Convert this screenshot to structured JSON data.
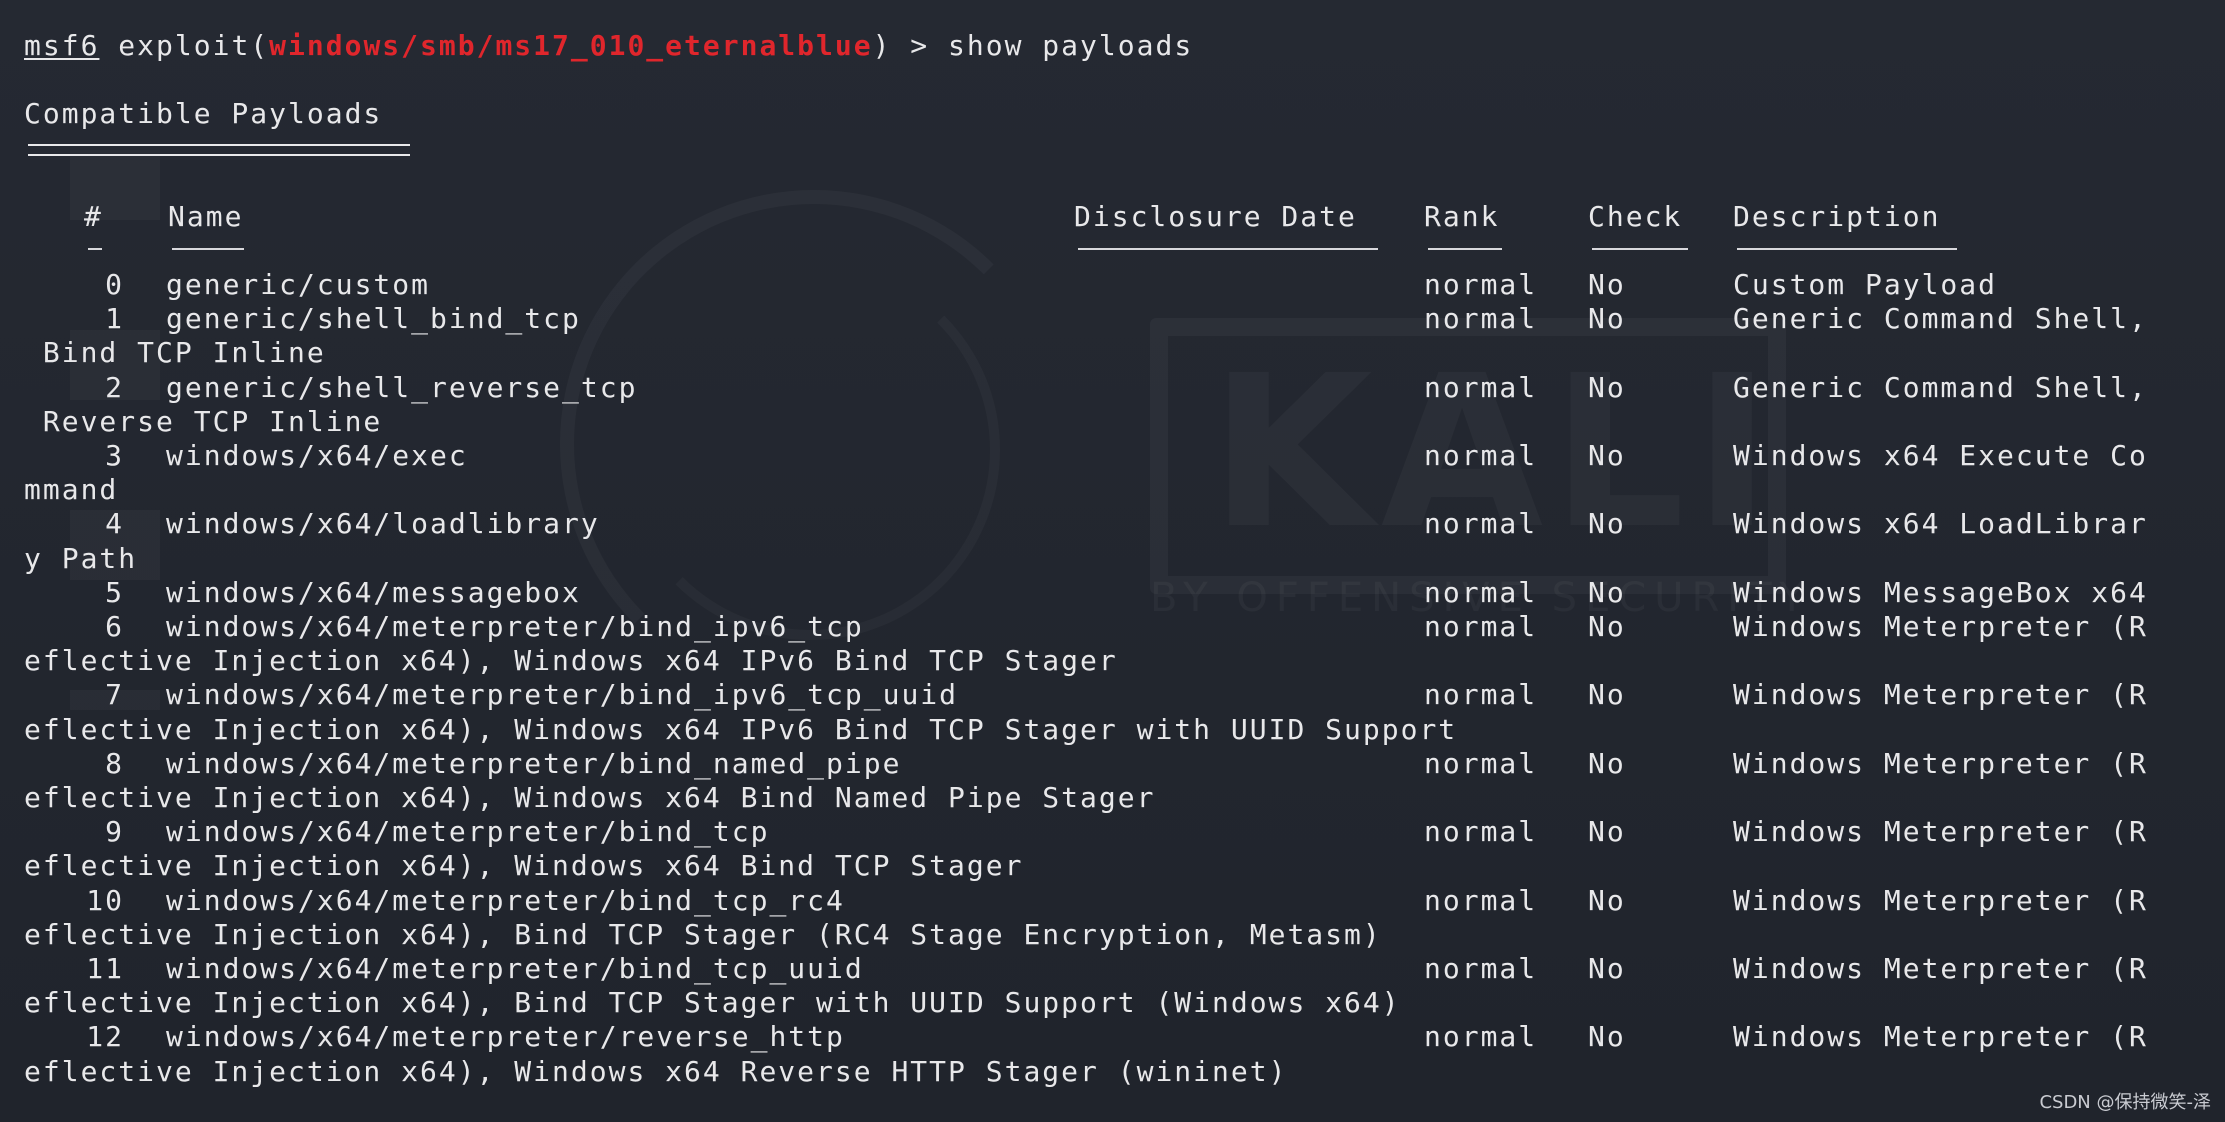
{
  "prompt": {
    "user": "msf6",
    "command_prefix": " exploit(",
    "module": "windows/smb/ms17_010_eternalblue",
    "command_suffix": ") > show payloads"
  },
  "section_title": "Compatible Payloads",
  "table": {
    "headers": [
      "#",
      "Name",
      "Disclosure Date",
      "Rank",
      "Check",
      "Description"
    ],
    "rows": [
      {
        "num": "0",
        "name": "generic/custom",
        "date": "",
        "rank": "normal",
        "check": "No",
        "desc_first": "Custom Payload",
        "desc_wrap": ""
      },
      {
        "num": "1",
        "name": "generic/shell_bind_tcp",
        "date": "",
        "rank": "normal",
        "check": "No",
        "desc_first": "Generic Command Shell,",
        "desc_wrap": " Bind TCP Inline"
      },
      {
        "num": "2",
        "name": "generic/shell_reverse_tcp",
        "date": "",
        "rank": "normal",
        "check": "No",
        "desc_first": "Generic Command Shell,",
        "desc_wrap": " Reverse TCP Inline"
      },
      {
        "num": "3",
        "name": "windows/x64/exec",
        "date": "",
        "rank": "normal",
        "check": "No",
        "desc_first": "Windows x64 Execute Co",
        "desc_wrap": "mmand"
      },
      {
        "num": "4",
        "name": "windows/x64/loadlibrary",
        "date": "",
        "rank": "normal",
        "check": "No",
        "desc_first": "Windows x64 LoadLibrar",
        "desc_wrap": "y Path"
      },
      {
        "num": "5",
        "name": "windows/x64/messagebox",
        "date": "",
        "rank": "normal",
        "check": "No",
        "desc_first": "Windows MessageBox x64",
        "desc_wrap": ""
      },
      {
        "num": "6",
        "name": "windows/x64/meterpreter/bind_ipv6_tcp",
        "date": "",
        "rank": "normal",
        "check": "No",
        "desc_first": "Windows Meterpreter (R",
        "desc_wrap": "eflective Injection x64), Windows x64 IPv6 Bind TCP Stager"
      },
      {
        "num": "7",
        "name": "windows/x64/meterpreter/bind_ipv6_tcp_uuid",
        "date": "",
        "rank": "normal",
        "check": "No",
        "desc_first": "Windows Meterpreter (R",
        "desc_wrap": "eflective Injection x64), Windows x64 IPv6 Bind TCP Stager with UUID Support"
      },
      {
        "num": "8",
        "name": "windows/x64/meterpreter/bind_named_pipe",
        "date": "",
        "rank": "normal",
        "check": "No",
        "desc_first": "Windows Meterpreter (R",
        "desc_wrap": "eflective Injection x64), Windows x64 Bind Named Pipe Stager"
      },
      {
        "num": "9",
        "name": "windows/x64/meterpreter/bind_tcp",
        "date": "",
        "rank": "normal",
        "check": "No",
        "desc_first": "Windows Meterpreter (R",
        "desc_wrap": "eflective Injection x64), Windows x64 Bind TCP Stager"
      },
      {
        "num": "10",
        "name": "windows/x64/meterpreter/bind_tcp_rc4",
        "date": "",
        "rank": "normal",
        "check": "No",
        "desc_first": "Windows Meterpreter (R",
        "desc_wrap": "eflective Injection x64), Bind TCP Stager (RC4 Stage Encryption, Metasm)"
      },
      {
        "num": "11",
        "name": "windows/x64/meterpreter/bind_tcp_uuid",
        "date": "",
        "rank": "normal",
        "check": "No",
        "desc_first": "Windows Meterpreter (R",
        "desc_wrap": "eflective Injection x64), Bind TCP Stager with UUID Support (Windows x64)"
      },
      {
        "num": "12",
        "name": "windows/x64/meterpreter/reverse_http",
        "date": "",
        "rank": "normal",
        "check": "No",
        "desc_first": "Windows Meterpreter (R",
        "desc_wrap": "eflective Injection x64), Windows x64 Reverse HTTP Stager (wininet)"
      }
    ]
  },
  "watermark": {
    "logo": "KALI",
    "tagline": "BY OFFENSIVE SECURITY"
  },
  "credit": "CSDN @保持微笑-泽",
  "colors": {
    "background": "#22262f",
    "text": "#e8e8ea",
    "module": "#e0262c"
  }
}
